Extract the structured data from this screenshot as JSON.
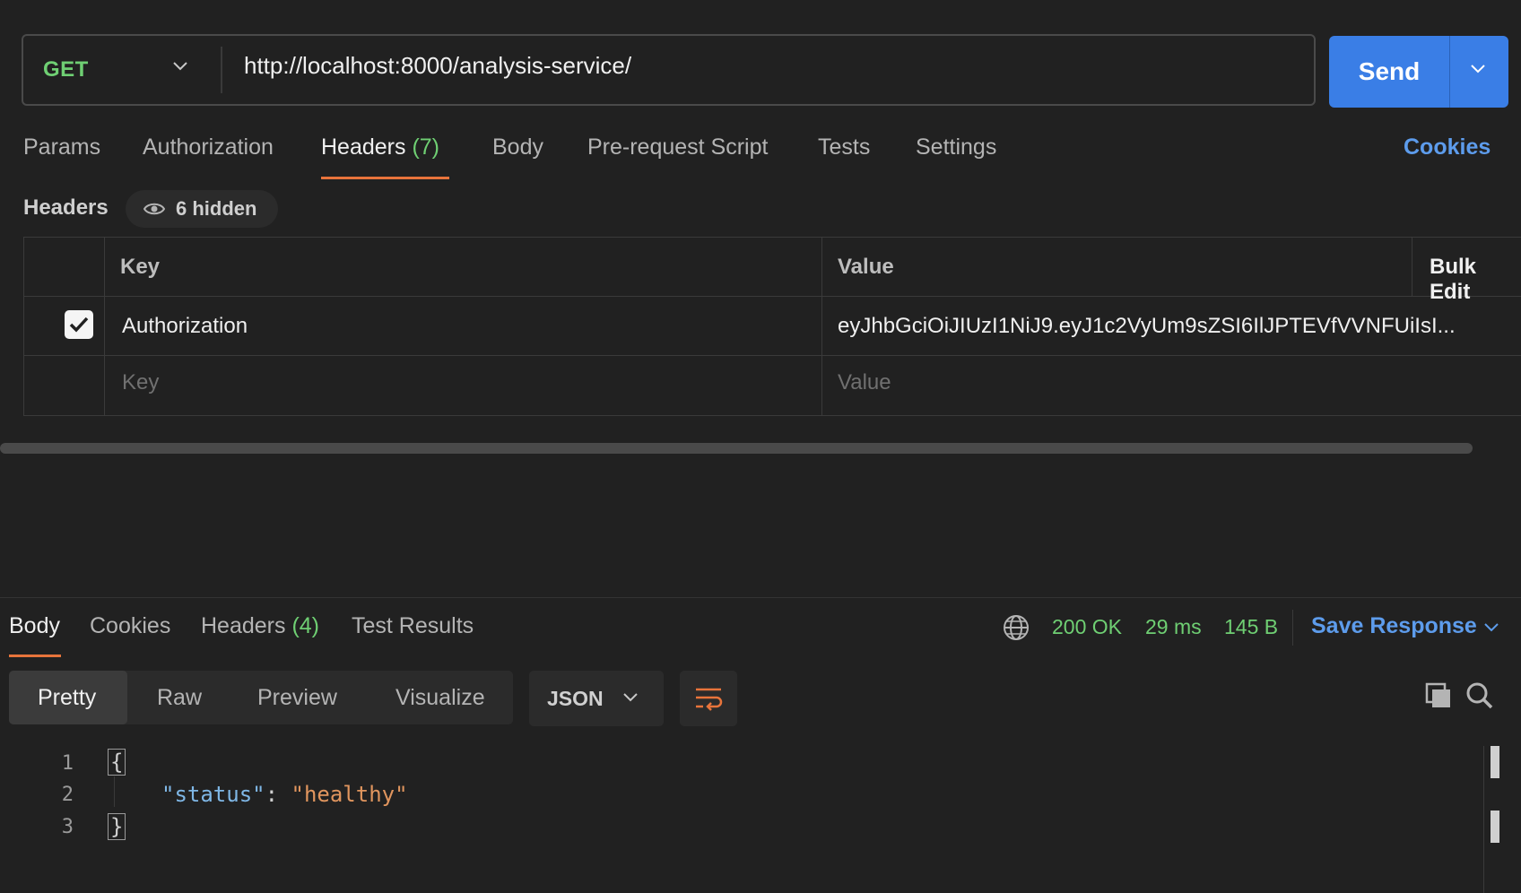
{
  "request": {
    "method": "GET",
    "url": "http://localhost:8000/analysis-service/",
    "send_label": "Send"
  },
  "request_tabs": [
    {
      "label": "Params"
    },
    {
      "label": "Authorization"
    },
    {
      "label": "Headers",
      "count": "(7)"
    },
    {
      "label": "Body"
    },
    {
      "label": "Pre-request Script"
    },
    {
      "label": "Tests"
    },
    {
      "label": "Settings"
    }
  ],
  "cookies_link": "Cookies",
  "headers_section": {
    "title": "Headers",
    "hidden_count": "6 hidden",
    "columns": {
      "key": "Key",
      "value": "Value",
      "bulk_edit": "Bulk Edit"
    },
    "rows": [
      {
        "checked": true,
        "key": "Authorization",
        "value": "eyJhbGciOiJIUzI1NiJ9.eyJ1c2VyUm9sZSI6IlJPTEVfVVNFUiIsI..."
      }
    ],
    "placeholders": {
      "key": "Key",
      "value": "Value"
    }
  },
  "response_tabs": [
    {
      "label": "Body"
    },
    {
      "label": "Cookies"
    },
    {
      "label": "Headers",
      "count": "(4)"
    },
    {
      "label": "Test Results"
    }
  ],
  "response_status": {
    "status": "200 OK",
    "time": "29 ms",
    "size": "145 B",
    "save_label": "Save Response"
  },
  "view_tabs": [
    "Pretty",
    "Raw",
    "Preview",
    "Visualize"
  ],
  "format": "JSON",
  "code": {
    "line_numbers": [
      "1",
      "2",
      "3"
    ],
    "open_brace": "{",
    "close_brace": "}",
    "key": "\"status\"",
    "colon": ": ",
    "value": "\"healthy\""
  },
  "colors": {
    "accent_orange": "#e8743b",
    "send_blue": "#3a7ee6",
    "status_green": "#6fcf73",
    "link_blue": "#5d9cec"
  }
}
